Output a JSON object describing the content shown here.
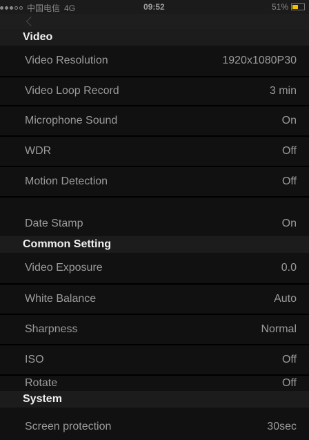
{
  "status_bar": {
    "carrier": "中国电信",
    "network": "4G",
    "time": "09:52",
    "battery_text": "51%",
    "battery_level": 0.51,
    "signal_filled": 3,
    "signal_total": 5,
    "battery_color": "#f2c200"
  },
  "nav": {
    "back_icon": "chevron-left-icon"
  },
  "sections": {
    "video": {
      "title": "Video",
      "rows": [
        {
          "label": "Video Resolution",
          "value": "1920x1080P30"
        },
        {
          "label": "Video Loop Record",
          "value": "3 min"
        },
        {
          "label": "Microphone Sound",
          "value": "On"
        },
        {
          "label": "WDR",
          "value": "Off"
        },
        {
          "label": "Motion Detection",
          "value": "Off"
        },
        {
          "label": "Date Stamp",
          "value": "On"
        }
      ]
    },
    "common": {
      "title": "Common Setting",
      "rows": [
        {
          "label": "Video Exposure",
          "value": "0.0"
        },
        {
          "label": "White Balance",
          "value": "Auto"
        },
        {
          "label": "Sharpness",
          "value": "Normal"
        },
        {
          "label": "ISO",
          "value": "Off"
        },
        {
          "label": "Rotate",
          "value": "Off"
        }
      ]
    },
    "system": {
      "title": "System",
      "rows": [
        {
          "label": "Screen protection",
          "value": "30sec"
        }
      ]
    }
  }
}
